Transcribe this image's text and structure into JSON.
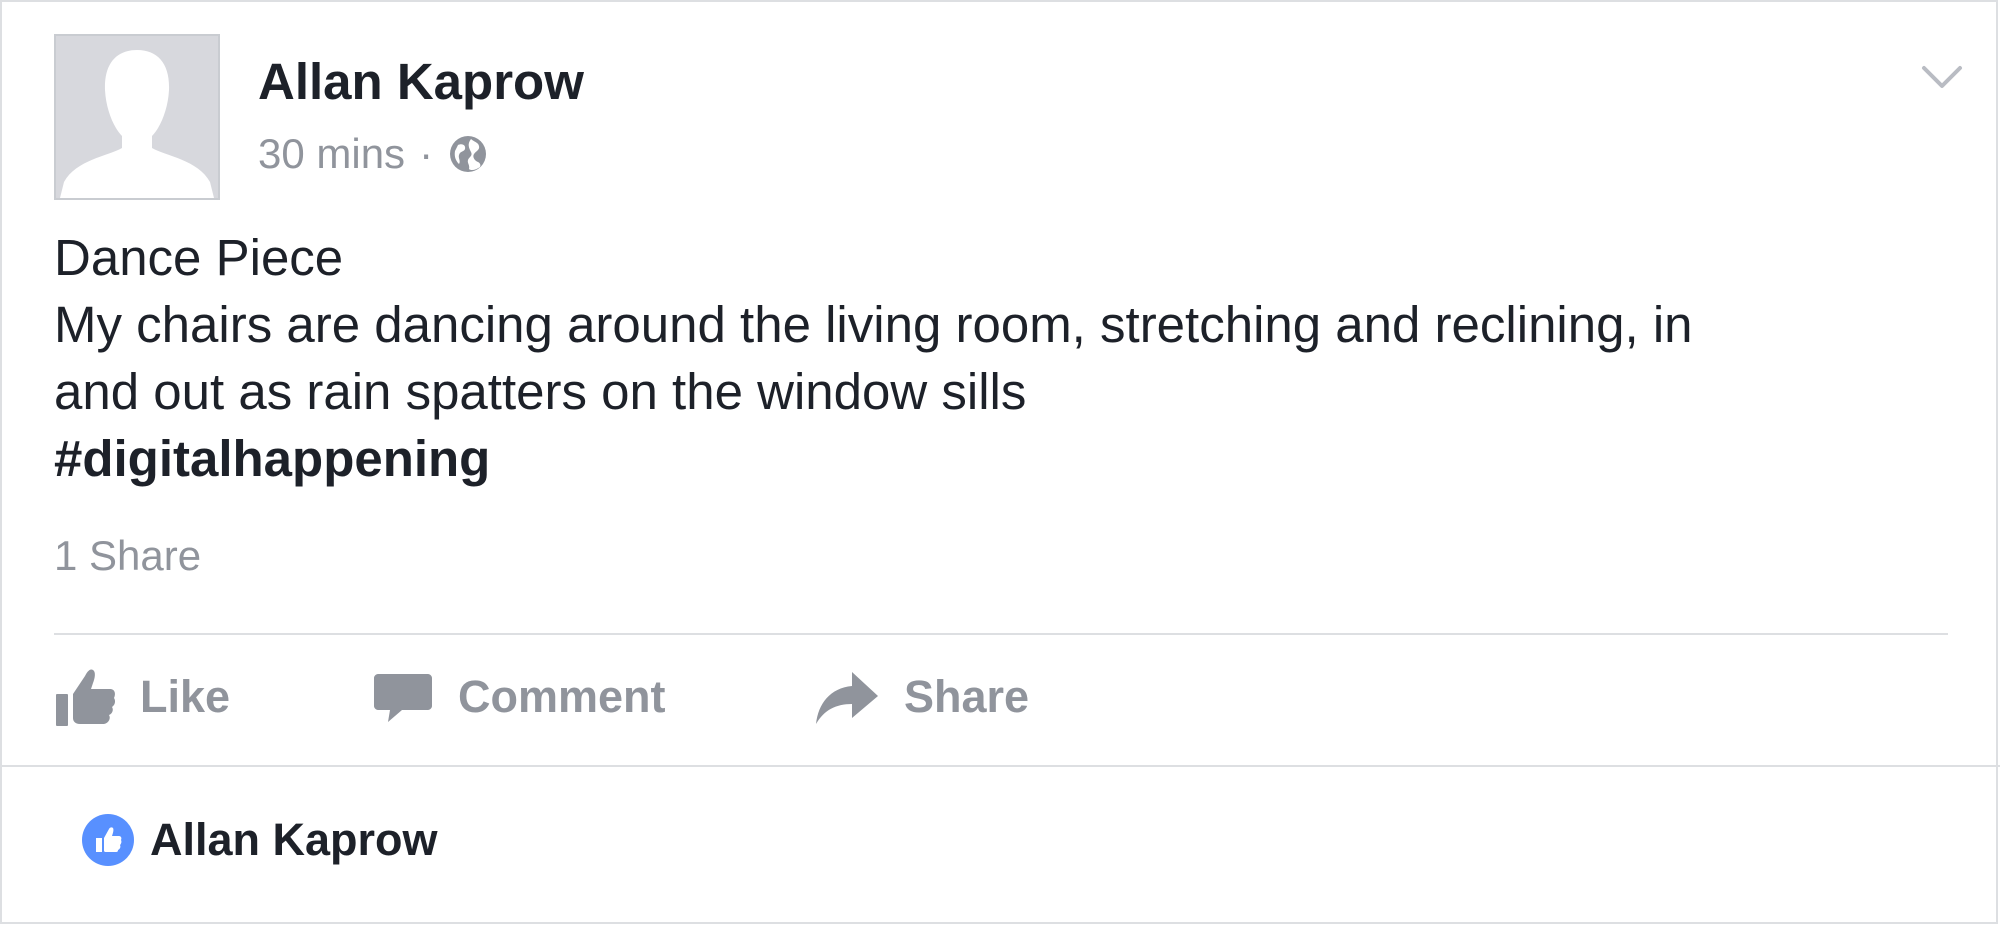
{
  "post": {
    "author": "Allan Kaprow",
    "time": "30 mins",
    "separator": "·",
    "privacy_icon": "globe-icon",
    "title": "Dance Piece",
    "body_lines": [
      "My chairs are dancing around the living room, stretching and reclining, in",
      "and out as rain spatters on the window sills"
    ],
    "hashtag": "#digitalhappening",
    "shares_label": "1 Share"
  },
  "actions": {
    "like_label": "Like",
    "comment_label": "Comment",
    "share_label": "Share"
  },
  "reactions": {
    "icon": "like-badge-icon",
    "liked_by": "Allan Kaprow"
  },
  "colors": {
    "text": "#1d2129",
    "secondary": "#90949c",
    "divider": "#dddfe2",
    "like_blue": "#5890ff",
    "avatar_bg": "#d7d8dd"
  }
}
